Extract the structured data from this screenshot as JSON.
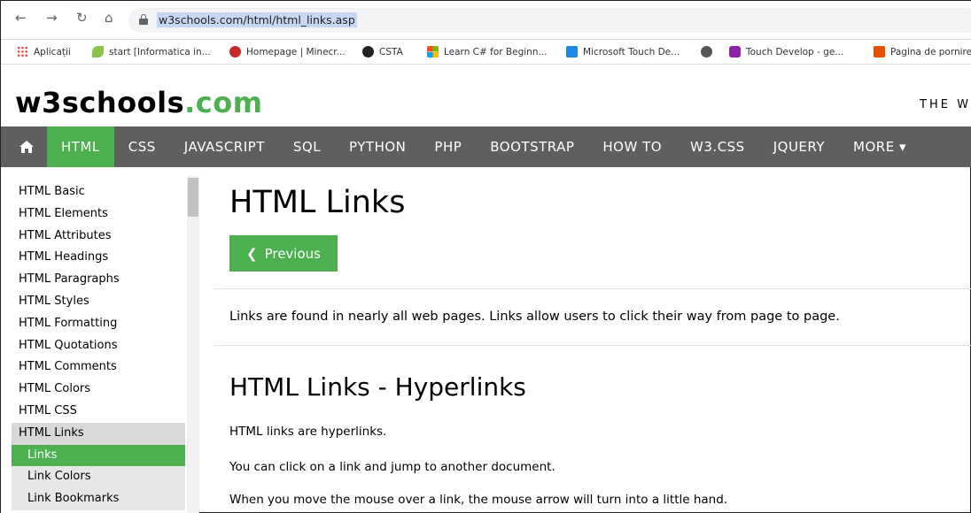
{
  "browser": {
    "url": "w3schools.com/html/html_links.asp",
    "bookmarks": [
      {
        "label": "Aplicații",
        "color": "#e8453c"
      },
      {
        "label": "start [Informatica in...",
        "color": "#8bc34a"
      },
      {
        "label": "Homepage | Minecr...",
        "color": "#c62828"
      },
      {
        "label": "CSTA",
        "color": "#222222"
      },
      {
        "label": "Learn C# for Beginn...",
        "color": "#f25022"
      },
      {
        "label": "Microsoft Touch De...",
        "color": "#1e88e5"
      },
      {
        "label": "",
        "color": "#555555"
      },
      {
        "label": "Touch Develop - ge...",
        "color": "#8e24aa"
      },
      {
        "label": "Pagina de pornire",
        "color": "#e65100"
      }
    ]
  },
  "site": {
    "logo_main": "w3schools",
    "logo_tld": ".com",
    "tagline": "THE W"
  },
  "topnav": {
    "home_icon": "home-icon",
    "items": [
      "HTML",
      "CSS",
      "JAVASCRIPT",
      "SQL",
      "PYTHON",
      "PHP",
      "BOOTSTRAP",
      "HOW TO",
      "W3.CSS",
      "JQUERY",
      "MORE ▾"
    ],
    "active_color": "#4CAF50",
    "bg_color": "#5f5f5f"
  },
  "sidebar": {
    "items": [
      "HTML Basic",
      "HTML Elements",
      "HTML Attributes",
      "HTML Headings",
      "HTML Paragraphs",
      "HTML Styles",
      "HTML Formatting",
      "HTML Quotations",
      "HTML Comments",
      "HTML Colors",
      "HTML CSS",
      "HTML Links",
      "Links",
      "Link Colors",
      "Link Bookmarks"
    ]
  },
  "main": {
    "title": "HTML Links",
    "prev_label": "Previous",
    "intro": "Links are found in nearly all web pages. Links allow users to click their way from page to page.",
    "subtitle": "HTML Links - Hyperlinks",
    "paragraphs": [
      "HTML links are hyperlinks.",
      "You can click on a link and jump to another document.",
      "When you move the mouse over a link, the mouse arrow will turn into a little hand."
    ]
  }
}
